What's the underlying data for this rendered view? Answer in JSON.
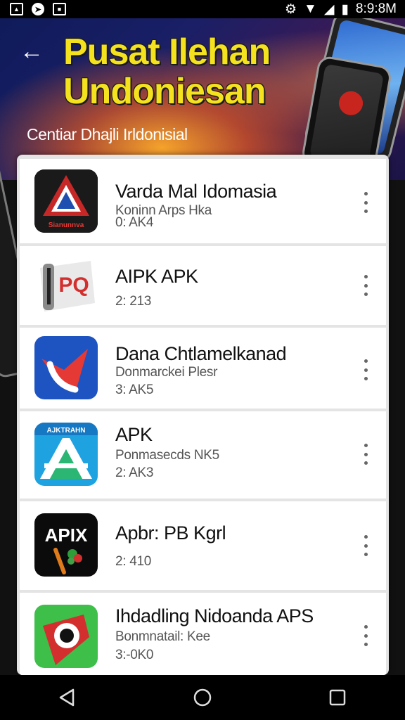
{
  "status_bar": {
    "time": "8:9:8M",
    "left_icons": [
      "gallery-icon",
      "nav-app-icon",
      "notification-app-icon"
    ],
    "right_icons": [
      "settings-icon",
      "wifi-icon",
      "signal-icon",
      "battery-icon"
    ]
  },
  "header": {
    "title_line1": "Pusat Ilehan",
    "title_line2": "Undoniesan",
    "subtitle": "Centiar Dhajli Irldonisial"
  },
  "apps": [
    {
      "name": "Varda Mal Idomasia",
      "meta1": "Koninn Arps Hka",
      "meta2": "0: AK4",
      "icon": "red-a-logo-icon",
      "icon_text": "Sianunnva"
    },
    {
      "name": "AIPK APK",
      "meta1": "",
      "meta2": "2: 213",
      "icon": "pq-logo-icon",
      "icon_text": "PQ"
    },
    {
      "name": "Dana Chtlamelkanad",
      "meta1": "Donmarckei Plesr",
      "meta2": "3: AK5",
      "icon": "blue-phone-check-icon",
      "icon_text": ""
    },
    {
      "name": "APK",
      "meta1": "Ponmasecds NK5",
      "meta2": "2: AK3",
      "icon": "cyan-a-logo-icon",
      "icon_text": "AJKTRAHN"
    },
    {
      "name": "Apbr: PB Kgrl",
      "meta1": "",
      "meta2": "2: 410",
      "icon": "apix-logo-icon",
      "icon_text": "APIX"
    },
    {
      "name": "Ihdadling Nidoanda APS",
      "meta1": "Bonmnatail: Kee",
      "meta2": "3:-0K0",
      "icon": "green-eye-logo-icon",
      "icon_text": ""
    }
  ],
  "nav_bar": {
    "buttons": [
      "back-triangle-icon",
      "home-circle-icon",
      "recents-square-icon"
    ]
  }
}
